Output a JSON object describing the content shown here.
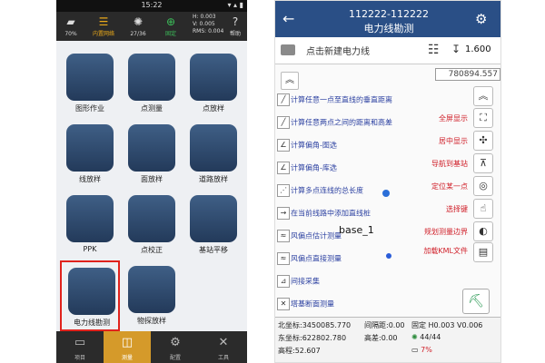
{
  "left_phone": {
    "status_bar": {
      "time": "15:22",
      "right": "▾ ▴ ▮"
    },
    "top_bar": {
      "battery": "70%",
      "network_label": "内置网络",
      "satellites": "27/36",
      "solution": "固定",
      "h_value": "H: 0.003",
      "v_value": "V: 0.005",
      "rms_value": "RMS: 0.004",
      "help_label": "帮助"
    },
    "apps": [
      {
        "label": "图形作业"
      },
      {
        "label": "点测量"
      },
      {
        "label": "点放样"
      },
      {
        "label": "线放样"
      },
      {
        "label": "面放样"
      },
      {
        "label": "道路放样"
      },
      {
        "label": "PPK"
      },
      {
        "label": "点校正"
      },
      {
        "label": "基站平移"
      },
      {
        "label": "电力线勘测"
      },
      {
        "label": "物探放样"
      }
    ],
    "selected_app": "电力线勘测",
    "bottom_nav": [
      "项目",
      "测量",
      "配置",
      "工具"
    ],
    "active_nav": "测量"
  },
  "right_phone": {
    "header": {
      "title_line1": "112222-112222",
      "title_line2": "电力线勘测"
    },
    "toolbar": {
      "new_line_label": "点击新建电力线",
      "pole_height": "1.600"
    },
    "map": {
      "coord_box": "780894.557",
      "menu_items": [
        "计算任意一点至直线的垂直距离",
        "计算任意两点之间的距离和高差",
        "计算偏角-图选",
        "计算偏角-库选",
        "计算多点连线的总长度",
        "在当前线路中添加直线桩",
        "风偏点估计测量",
        "风偏点直接测量",
        "间接采集",
        "塔基断面测量"
      ],
      "side_labels": [
        "全屏显示",
        "居中显示",
        "导航到基站",
        "定位某一点",
        "选择键",
        "规划测量边界",
        "加载KML文件"
      ],
      "base_label": "base_1"
    },
    "bottom": {
      "north": "北坐标:3450085.770",
      "interval": "间隔距:0.00",
      "east": "东坐标:622802.780",
      "height_diff": "高差:0.00",
      "elevation": "高程:52.607",
      "fix_line": "固定 H0.003 V0.006",
      "satellites": "44/44",
      "battery": "7%"
    }
  }
}
